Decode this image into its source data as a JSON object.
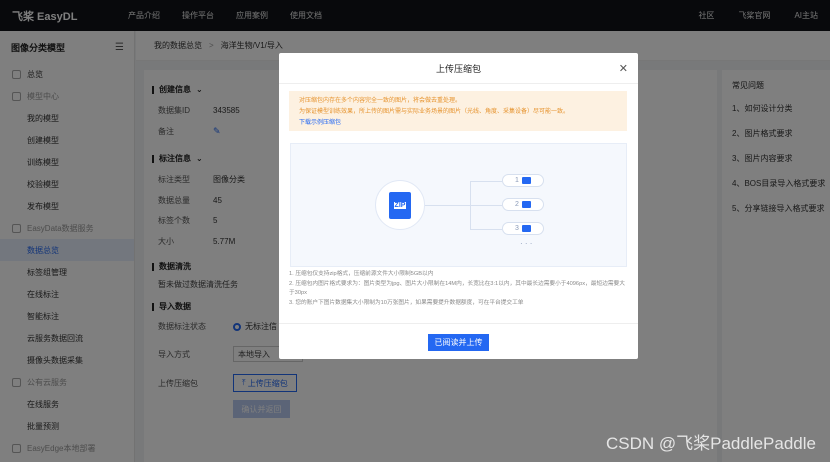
{
  "topnav": {
    "logo_mark": "飞桨",
    "logo_text": "飞桨 EasyDL",
    "items": [
      "产品介绍",
      "操作平台",
      "应用案例",
      "使用文档"
    ],
    "right_items": [
      "社区",
      "飞桨官网",
      "AI主站"
    ]
  },
  "sidebar": {
    "title": "图像分类模型",
    "items": [
      {
        "label": "总览",
        "type": "top"
      },
      {
        "label": "模型中心",
        "type": "group"
      },
      {
        "label": "我的模型",
        "type": "item"
      },
      {
        "label": "创建模型",
        "type": "item"
      },
      {
        "label": "训练模型",
        "type": "item"
      },
      {
        "label": "校验模型",
        "type": "item"
      },
      {
        "label": "发布模型",
        "type": "item"
      },
      {
        "label": "EasyData数据服务",
        "type": "group"
      },
      {
        "label": "数据总览",
        "type": "item",
        "active": true
      },
      {
        "label": "标签组管理",
        "type": "item"
      },
      {
        "label": "在线标注",
        "type": "item"
      },
      {
        "label": "智能标注",
        "type": "item"
      },
      {
        "label": "云服务数据回流",
        "type": "item"
      },
      {
        "label": "摄像头数据采集",
        "type": "item"
      },
      {
        "label": "公有云服务",
        "type": "group"
      },
      {
        "label": "在线服务",
        "type": "item"
      },
      {
        "label": "批量预测",
        "type": "item"
      },
      {
        "label": "EasyEdge本地部署",
        "type": "group"
      }
    ]
  },
  "breadcrumb": {
    "parent": "我的数据总览",
    "current": "海洋生物/V1/导入"
  },
  "create_info": {
    "title": "创建信息",
    "dataset_id_label": "数据集ID",
    "dataset_id": "343585",
    "note_label": "备注"
  },
  "label_info": {
    "title": "标注信息",
    "rows": [
      {
        "k": "标注类型",
        "v": "图像分类"
      },
      {
        "k": "数据总量",
        "v": "45"
      },
      {
        "k": "标签个数",
        "v": "5"
      },
      {
        "k": "大小",
        "v": "5.77M"
      }
    ]
  },
  "cleaning": {
    "title": "数据清洗",
    "text": "暂未做过数据清洗任务"
  },
  "import": {
    "title": "导入数据",
    "status_label": "数据标注状态",
    "status_value": "无标注信",
    "method_label": "导入方式",
    "method_value": "本地导入",
    "upload_label": "上传压缩包",
    "upload_button": "上传压缩包",
    "confirm_button": "确认并返回"
  },
  "faq": {
    "title": "常见问题",
    "items": [
      "1、如何设计分类",
      "2、图片格式要求",
      "3、图片内容要求",
      "4、BOS目录导入格式要求",
      "5、分享链接导入格式要求"
    ]
  },
  "modal": {
    "title": "上传压缩包",
    "notice_line1": "对压缩包内存在多个内容完全一致的图片，将会做去重处理。",
    "notice_line2": "为保证模型训练效果，所上传的图片需与实际业务场景的图片（光线、角度、采集设备）尽可能一致。",
    "notice_link": "下载示例压缩包",
    "zip_label": "ZIP",
    "thumbs": [
      "1",
      "2",
      "3"
    ],
    "dots": "· · ·",
    "rules": [
      "1. 压缩包仅支持zip格式，压缩前源文件大小限制5GB以内",
      "2. 压缩包内图片格式要求为：图片类型为jpg、图片大小限制在14M内，长宽比在3:1以内，其中最长边需要小于4096px，最短边需要大于30px",
      "3. 您的账户下图片数据集大小限制为10万张图片，如果需要提升数据额度，可在平台提交工单"
    ],
    "primary_button": "已阅读并上传"
  },
  "watermark": "CSDN @飞桨PaddlePaddle"
}
